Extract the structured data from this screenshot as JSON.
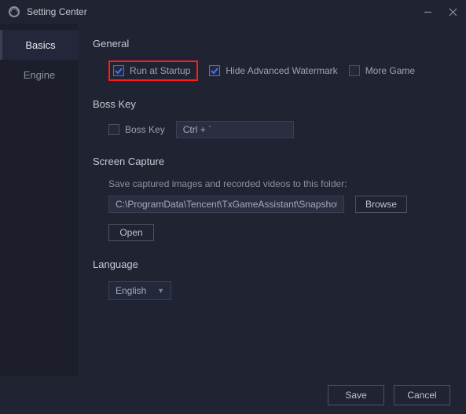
{
  "title": "Setting Center",
  "sidebar": {
    "items": [
      {
        "label": "Basics",
        "active": true
      },
      {
        "label": "Engine",
        "active": false
      }
    ]
  },
  "sections": {
    "general": {
      "title": "General",
      "runAtStartup": {
        "label": "Run at Startup",
        "checked": true,
        "highlighted": true
      },
      "hideWatermark": {
        "label": "Hide Advanced Watermark",
        "checked": true
      },
      "moreGame": {
        "label": "More Game",
        "checked": false
      }
    },
    "bossKey": {
      "title": "Boss Key",
      "enable": {
        "label": "Boss Key",
        "checked": false
      },
      "hotkey": "Ctrl + `"
    },
    "screenCapture": {
      "title": "Screen Capture",
      "desc": "Save captured images and recorded videos to this folder:",
      "path": "C:\\ProgramData\\Tencent\\TxGameAssistant\\Snapshot",
      "browse": "Browse",
      "open": "Open"
    },
    "language": {
      "title": "Language",
      "selected": "English"
    }
  },
  "footer": {
    "save": "Save",
    "cancel": "Cancel"
  }
}
